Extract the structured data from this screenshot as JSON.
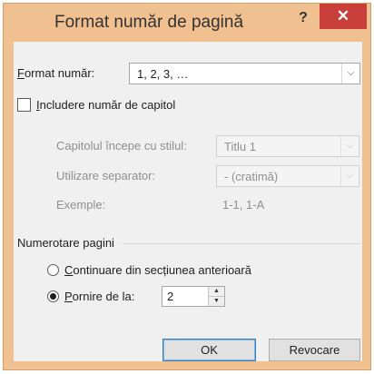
{
  "window": {
    "title": "Format număr de pagină",
    "help_label": "?",
    "close_label": "✕"
  },
  "format": {
    "label_first": "F",
    "label_rest": "ormat număr:",
    "value": "1, 2, 3, …"
  },
  "chapter": {
    "checkbox_first": "I",
    "checkbox_rest": "ncludere număr de capitol",
    "starts_with_label": "Capitolul începe cu stilul:",
    "starts_with_value": "Titlu 1",
    "separator_label": "Utilizare separator:",
    "separator_value": "-   (cratimă)",
    "examples_label": "Exemple:",
    "examples_value": "1-1, 1-A"
  },
  "numbering": {
    "section_label": "Numerotare pagini",
    "continue_first": "C",
    "continue_rest": "ontinuare din secțiunea anterioară",
    "start_first": "P",
    "start_rest": "ornire de la:",
    "start_value": "2"
  },
  "buttons": {
    "ok": "OK",
    "cancel": "Revocare"
  }
}
